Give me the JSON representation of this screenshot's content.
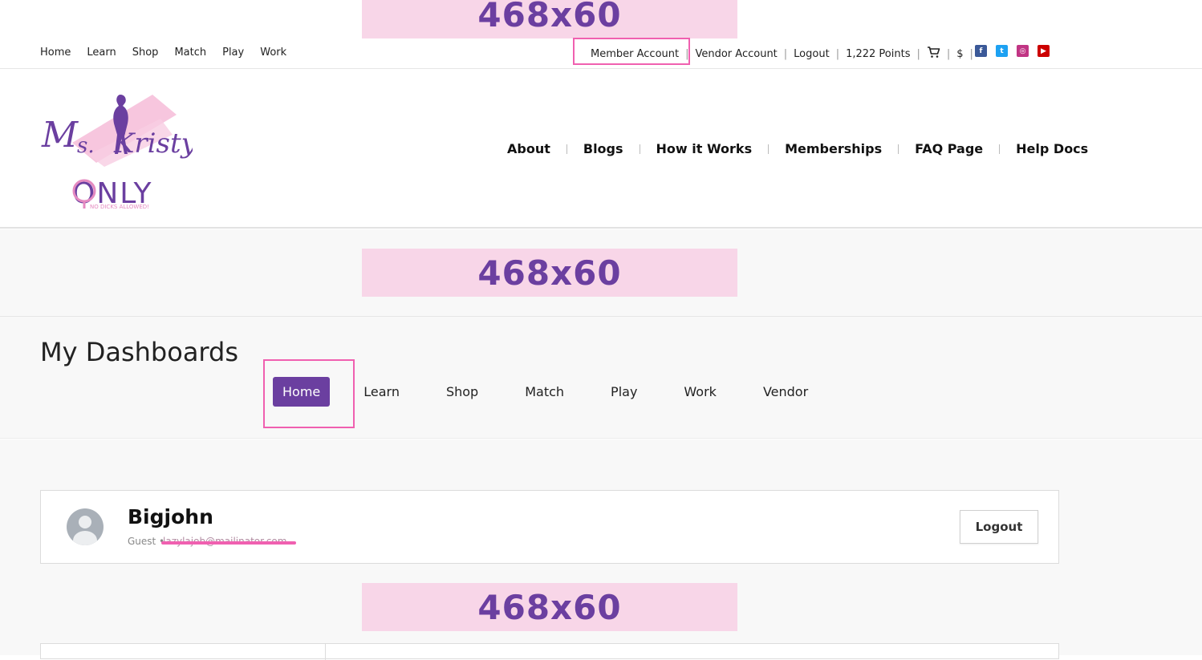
{
  "ads": {
    "top": "468x60",
    "middle": "468x60",
    "bottom": "468x60"
  },
  "topnav": [
    "Home",
    "Learn",
    "Shop",
    "Match",
    "Play",
    "Work"
  ],
  "account_links": {
    "member": "Member Account",
    "vendor": "Vendor Account",
    "logout": "Logout",
    "points": "1,222 Points",
    "currency": "$"
  },
  "social": [
    {
      "icon": "facebook-icon",
      "color": "#3b5998",
      "glyph": "f"
    },
    {
      "icon": "twitter-icon",
      "color": "#1da1f2",
      "glyph": "t"
    },
    {
      "icon": "instagram-icon",
      "color": "#c13584",
      "glyph": "◎"
    },
    {
      "icon": "youtube-icon",
      "color": "#cc0000",
      "glyph": "▶"
    }
  ],
  "logo": {
    "script": "Ms. Kristy's",
    "word": "ONLY",
    "tagline": "NO DICKS ALLOWED!"
  },
  "mainnav": [
    "About",
    "Blogs",
    "How it Works",
    "Memberships",
    "FAQ Page",
    "Help Docs"
  ],
  "dashboard": {
    "title": "My Dashboards",
    "tabs": [
      "Home",
      "Learn",
      "Shop",
      "Match",
      "Play",
      "Work",
      "Vendor"
    ],
    "active": "Home"
  },
  "profile": {
    "name": "Bigjohn",
    "role": "Guest •",
    "email": "lazylajob@mailinator.com",
    "logout_label": "Logout"
  },
  "colors": {
    "accent": "#6b3fa0",
    "highlight": "#f060b0",
    "ad_bg": "#f8d6e8"
  }
}
